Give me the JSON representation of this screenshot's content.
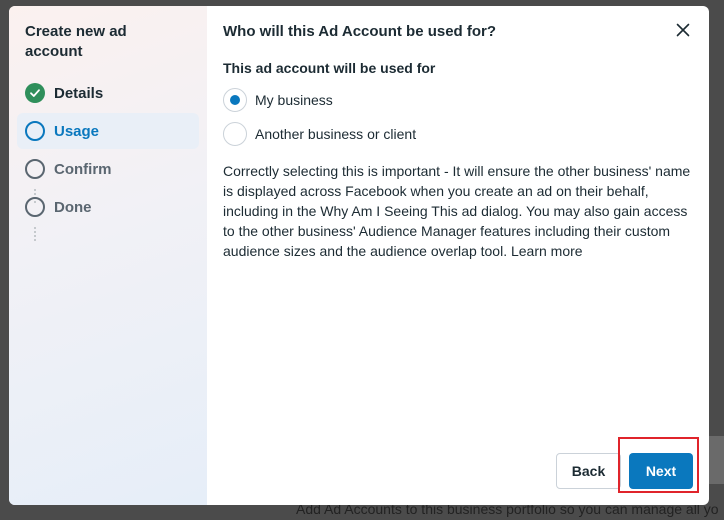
{
  "sidebar": {
    "title": "Create new ad account",
    "steps": [
      {
        "label": "Details",
        "state": "done"
      },
      {
        "label": "Usage",
        "state": "current"
      },
      {
        "label": "Confirm",
        "state": "todo"
      },
      {
        "label": "Done",
        "state": "todo"
      }
    ]
  },
  "main": {
    "title": "Who will this Ad Account be used for?",
    "section_label": "This ad account will be used for",
    "options": [
      {
        "label": "My business",
        "selected": true
      },
      {
        "label": "Another business or client",
        "selected": false
      }
    ],
    "description": "Correctly selecting this is important - It will ensure the other business' name is displayed across Facebook when you create an ad on their behalf, including in the Why Am I Seeing This ad dialog. You may also gain access to the other business' Audience Manager features including their custom audience sizes and the audience overlap tool.",
    "learn_more": "Learn more"
  },
  "footer": {
    "back_label": "Back",
    "next_label": "Next"
  },
  "backdrop": {
    "text": "Add Ad Accounts to this business portfolio so you can manage all yo"
  },
  "colors": {
    "accent": "#0a78be",
    "success": "#2f8f5b",
    "highlight": "#e0242b"
  },
  "icons": {
    "close": "close-icon",
    "check": "check-icon"
  }
}
